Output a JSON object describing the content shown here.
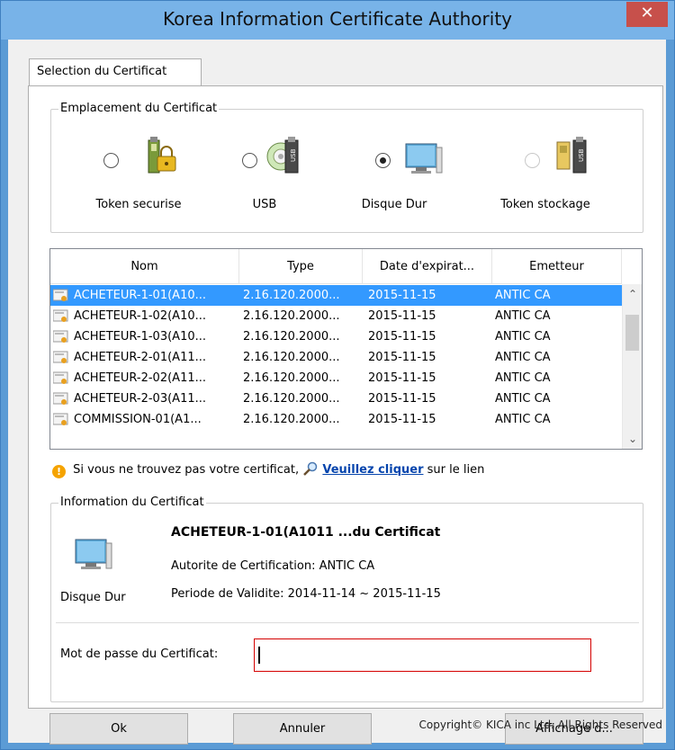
{
  "window": {
    "title": "Korea Information Certificate Authority",
    "close_glyph": "✕"
  },
  "tab": {
    "label": "Selection du Certificat"
  },
  "location": {
    "group_label": "Emplacement du Certificat",
    "options": [
      {
        "label": "Token securise",
        "icon": "secure-token-icon",
        "checked": false,
        "enabled": true
      },
      {
        "label": "USB",
        "icon": "usb-icon",
        "checked": false,
        "enabled": true
      },
      {
        "label": "Disque Dur",
        "icon": "hard-disk-icon",
        "checked": true,
        "enabled": true
      },
      {
        "label": "Token stockage",
        "icon": "storage-token-icon",
        "checked": false,
        "enabled": false
      }
    ]
  },
  "cert_list": {
    "columns": [
      "Nom",
      "Type",
      "Date d'expirat...",
      "Emetteur"
    ],
    "rows": [
      {
        "nom": "ACHETEUR-1-01(A10...",
        "type": "2.16.120.2000...",
        "date": "2015-11-15",
        "emetteur": "ANTIC CA",
        "selected": true
      },
      {
        "nom": "ACHETEUR-1-02(A10...",
        "type": "2.16.120.2000...",
        "date": "2015-11-15",
        "emetteur": "ANTIC CA",
        "selected": false
      },
      {
        "nom": "ACHETEUR-1-03(A10...",
        "type": "2.16.120.2000...",
        "date": "2015-11-15",
        "emetteur": "ANTIC CA",
        "selected": false
      },
      {
        "nom": "ACHETEUR-2-01(A11...",
        "type": "2.16.120.2000...",
        "date": "2015-11-15",
        "emetteur": "ANTIC CA",
        "selected": false
      },
      {
        "nom": "ACHETEUR-2-02(A11...",
        "type": "2.16.120.2000...",
        "date": "2015-11-15",
        "emetteur": "ANTIC CA",
        "selected": false
      },
      {
        "nom": "ACHETEUR-2-03(A11...",
        "type": "2.16.120.2000...",
        "date": "2015-11-15",
        "emetteur": "ANTIC CA",
        "selected": false
      },
      {
        "nom": "COMMISSION-01(A1...",
        "type": "2.16.120.2000...",
        "date": "2015-11-15",
        "emetteur": "ANTIC CA",
        "selected": false
      }
    ]
  },
  "notice": {
    "prefix": "Si vous ne trouvez pas votre certificat,",
    "link": "Veuillez cliquer",
    "suffix": "sur le lien"
  },
  "info": {
    "group_label": "Information du Certificat",
    "media_label": "Disque Dur",
    "cert_name": "ACHETEUR-1-01(A1011 ...du Certificat",
    "authority": "Autorite de Certification: ANTIC CA",
    "validity": "Periode de Validite: 2014-11-14 ~ 2015-11-15",
    "password_label": "Mot de passe du Certificat:",
    "password_value": ""
  },
  "buttons": {
    "ok": "Ok",
    "cancel": "Annuler",
    "view": "Affichage d..."
  },
  "footer": {
    "copyright": "Copyright© KICA inc Ltd. All Rights Reserved"
  }
}
